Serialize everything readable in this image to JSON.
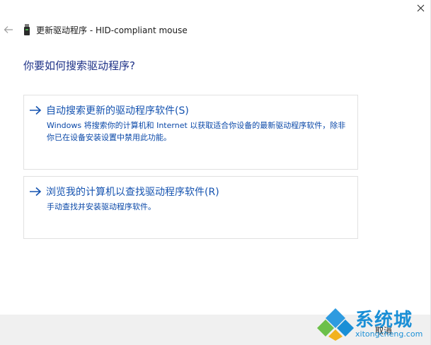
{
  "window": {
    "close_glyph": "✕",
    "title": "更新驱动程序 - HID-compliant mouse",
    "back_icon": "back-arrow-icon",
    "device_icon": "usb-device-icon"
  },
  "main": {
    "heading": "你要如何搜索驱动程序?",
    "options": [
      {
        "title": "自动搜索更新的驱动程序软件(S)",
        "description": "Windows 将搜索你的计算机和 Internet 以获取适合你设备的最新驱动程序软件，除非你已在设备安装设置中禁用此功能。",
        "icon": "right-arrow-icon"
      },
      {
        "title": "浏览我的计算机以查找驱动程序软件(R)",
        "description": "手动查找并安装驱动程序软件。",
        "icon": "right-arrow-icon"
      }
    ]
  },
  "footer": {
    "cancel_label": "取消"
  },
  "watermark": {
    "brand": "系统城",
    "url": "xitongcheng.com"
  },
  "colors": {
    "heading": "#1e3287",
    "link": "#1553b0",
    "footer_bg": "#f0f0f0",
    "brand": "#1a8fd6"
  }
}
